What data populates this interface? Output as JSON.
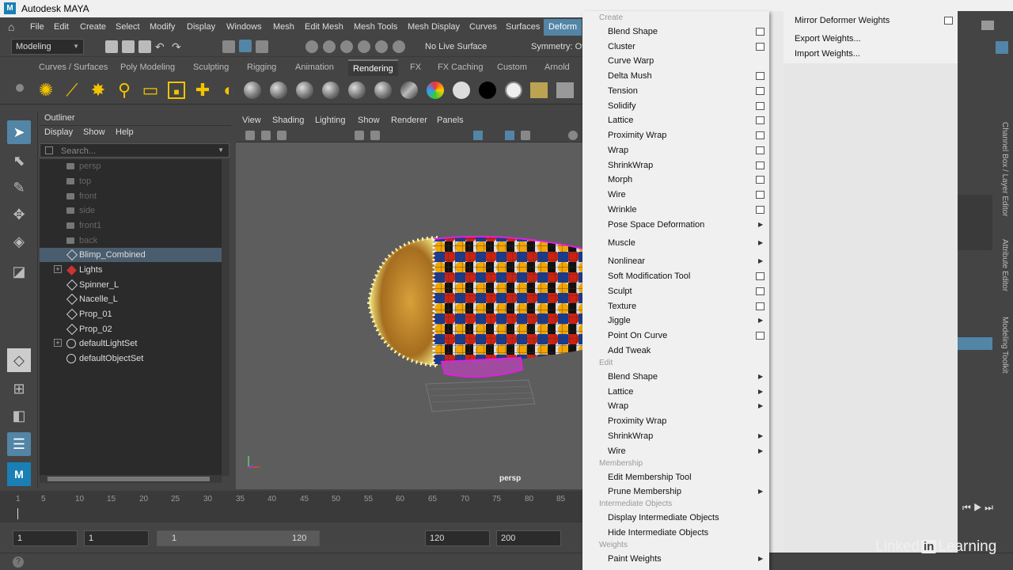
{
  "window": {
    "title": "Autodesk MAYA",
    "logo": "M"
  },
  "menubar": [
    "File",
    "Edit",
    "Create",
    "Select",
    "Modify",
    "Display",
    "Windows",
    "Mesh",
    "Edit Mesh",
    "Mesh Tools",
    "Mesh Display",
    "Curves",
    "Surfaces",
    "Deform"
  ],
  "statusline": {
    "mode": "Modeling",
    "live_surface": "No Live Surface",
    "symmetry": "Symmetry: Off"
  },
  "shelf_tabs": [
    "Curves / Surfaces",
    "Poly Modeling",
    "Sculpting",
    "Rigging",
    "Animation",
    "Rendering",
    "FX",
    "FX Caching",
    "Custom",
    "Arnold"
  ],
  "shelf_active": "Rendering",
  "outliner": {
    "title": "Outliner",
    "menu": [
      "Display",
      "Show",
      "Help"
    ],
    "search_placeholder": "Search...",
    "items": [
      {
        "label": "persp",
        "type": "camera",
        "dim": true
      },
      {
        "label": "top",
        "type": "camera",
        "dim": true
      },
      {
        "label": "front",
        "type": "camera",
        "dim": true
      },
      {
        "label": "side",
        "type": "camera",
        "dim": true
      },
      {
        "label": "front1",
        "type": "camera",
        "dim": true
      },
      {
        "label": "back",
        "type": "camera",
        "dim": true
      },
      {
        "label": "Blimp_Combined",
        "type": "mesh",
        "selected": true
      },
      {
        "label": "Lights",
        "type": "group",
        "expand": true
      },
      {
        "label": "Spinner_L",
        "type": "mesh"
      },
      {
        "label": "Nacelle_L",
        "type": "mesh"
      },
      {
        "label": "Prop_01",
        "type": "mesh"
      },
      {
        "label": "Prop_02",
        "type": "mesh"
      },
      {
        "label": "defaultLightSet",
        "type": "set",
        "expand": true
      },
      {
        "label": "defaultObjectSet",
        "type": "set"
      }
    ]
  },
  "viewport": {
    "menu": [
      "View",
      "Shading",
      "Lighting",
      "Show",
      "Renderer",
      "Panels"
    ],
    "camera_label": "persp"
  },
  "timeline": {
    "ticks": [
      "5",
      "10",
      "15",
      "20",
      "25",
      "30",
      "35",
      "40",
      "45",
      "50",
      "55",
      "60",
      "65",
      "70",
      "75",
      "80",
      "85"
    ],
    "start_tick": "1"
  },
  "range": {
    "start": "1",
    "playback_start": "1",
    "slider_start": "1",
    "slider_end": "120",
    "playback_end": "120",
    "end": "200"
  },
  "deform_menu": {
    "create_section": "Create",
    "create_items": [
      {
        "label": "Blend Shape",
        "box": true
      },
      {
        "label": "Cluster",
        "box": true
      },
      {
        "label": "Curve Warp",
        "box": false
      },
      {
        "label": "Delta Mush",
        "box": true
      },
      {
        "label": "Tension",
        "box": true
      },
      {
        "label": "Solidify",
        "box": true
      },
      {
        "label": "Lattice",
        "box": true
      },
      {
        "label": "Proximity Wrap",
        "box": true
      },
      {
        "label": "Wrap",
        "box": true
      },
      {
        "label": "ShrinkWrap",
        "box": true
      },
      {
        "label": "Morph",
        "box": true
      },
      {
        "label": "Wire",
        "box": true
      },
      {
        "label": "Wrinkle",
        "box": true
      },
      {
        "label": "Pose Space Deformation",
        "sub": true
      },
      {
        "label": "Muscle",
        "sub": true
      },
      {
        "label": "Nonlinear",
        "sub": true
      },
      {
        "label": "Soft Modification Tool",
        "box": true
      },
      {
        "label": "Sculpt",
        "box": true
      },
      {
        "label": "Texture",
        "box": true
      },
      {
        "label": "Jiggle",
        "sub": true
      },
      {
        "label": "Point On Curve",
        "box": true
      },
      {
        "label": "Add Tweak"
      }
    ],
    "edit_section": "Edit",
    "edit_items": [
      {
        "label": "Blend Shape",
        "sub": true
      },
      {
        "label": "Lattice",
        "sub": true
      },
      {
        "label": "Wrap",
        "sub": true
      },
      {
        "label": "Proximity Wrap"
      },
      {
        "label": "ShrinkWrap",
        "sub": true
      },
      {
        "label": "Wire",
        "sub": true
      }
    ],
    "membership_section": "Membership",
    "membership_items": [
      {
        "label": "Edit Membership Tool"
      },
      {
        "label": "Prune Membership",
        "sub": true
      }
    ],
    "intermediate_section": "Intermediate Objects",
    "intermediate_items": [
      {
        "label": "Display Intermediate Objects"
      },
      {
        "label": "Hide Intermediate Objects"
      }
    ],
    "weights_section": "Weights",
    "weights_items": [
      {
        "label": "Paint Weights",
        "sub": true
      }
    ]
  },
  "weights_submenu": [
    "Mirror Deformer Weights",
    "Export Weights...",
    "Import Weights..."
  ],
  "right_panel_tabs": [
    "Channel Box / Layer Editor",
    "Attribute Editor",
    "Modeling Toolkit"
  ],
  "watermark": {
    "pre": "Linked",
    "in": "in",
    "post": "Learning"
  },
  "colors": {
    "accent": "#5285a6",
    "menu_bg": "#f0f0f0",
    "ui_bg": "#444444"
  }
}
